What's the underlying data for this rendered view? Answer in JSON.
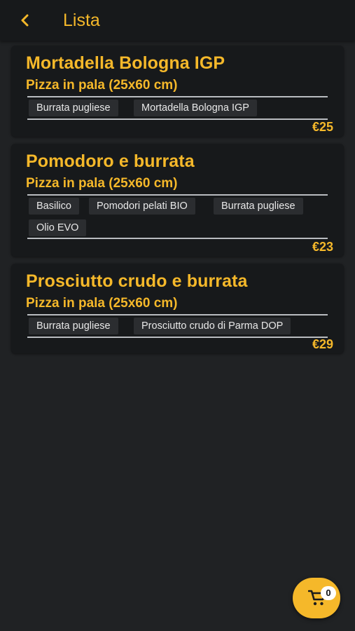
{
  "header": {
    "title": "Lista",
    "back_icon": "chevron-left-icon"
  },
  "colors": {
    "accent": "#f5b82a",
    "background": "#202224",
    "card": "#17191b",
    "chip": "#2b2d30"
  },
  "products": [
    {
      "name": "Mortadella Bologna IGP",
      "format": "Pizza in pala (25x60 cm)",
      "ingredients": [
        "Burrata pugliese",
        "Mortadella Bologna IGP"
      ],
      "price": "€25"
    },
    {
      "name": "Pomodoro e burrata",
      "format": "Pizza in pala (25x60 cm)",
      "ingredients": [
        "Basilico",
        "Pomodori pelati BIO",
        "Burrata pugliese",
        "Olio EVO"
      ],
      "price": "€23"
    },
    {
      "name": "Prosciutto crudo e burrata",
      "format": "Pizza in pala (25x60 cm)",
      "ingredients": [
        "Burrata pugliese",
        "Prosciutto crudo di Parma DOP"
      ],
      "price": "€29"
    }
  ],
  "cart": {
    "icon": "cart-icon",
    "count": "0"
  }
}
